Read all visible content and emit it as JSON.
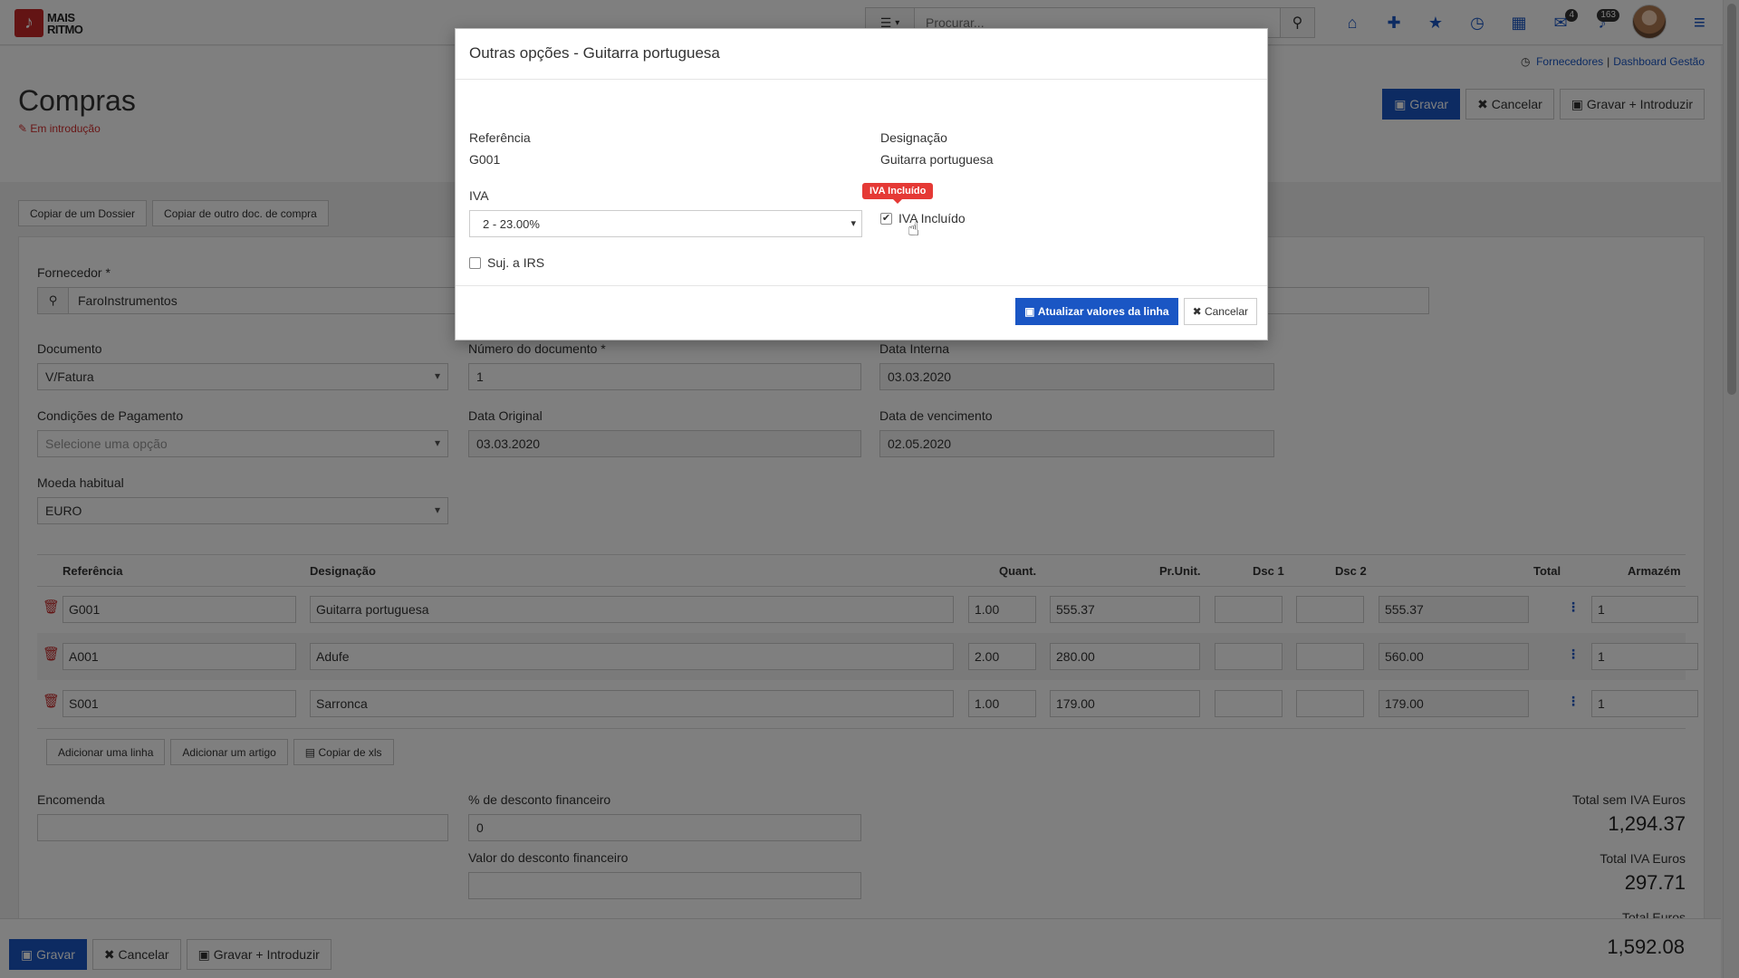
{
  "brand": {
    "line1": "MAIS",
    "line2": "RITMO",
    "color": "#c62828"
  },
  "search": {
    "placeholder": "Procurar..."
  },
  "nav": {
    "mail_badge": "4",
    "notif_badge": "163"
  },
  "breadcrumb": {
    "item1": "Fornecedores",
    "separator": "|",
    "item2": "Dashboard Gestão"
  },
  "page": {
    "title": "Compras",
    "status": "Em introdução"
  },
  "header_buttons": {
    "save": "Gravar",
    "cancel": "Cancelar",
    "save_new": "Gravar + Introduzir"
  },
  "copy_buttons": {
    "from_dossier": "Copiar de um Dossier",
    "from_other": "Copiar de outro doc. de compra"
  },
  "form": {
    "fornecedor_label": "Fornecedor *",
    "fornecedor_value": "FaroInstrumentos",
    "documento_label": "Documento",
    "documento_value": "V/Fatura",
    "numero_label": "Número do documento *",
    "numero_value": "1",
    "data_interna_label": "Data Interna",
    "data_interna_value": "03.03.2020",
    "condicoes_label": "Condições de Pagamento",
    "condicoes_placeholder": "Selecione uma opção",
    "data_original_label": "Data Original",
    "data_original_value": "03.03.2020",
    "data_venc_label": "Data de vencimento",
    "data_venc_value": "02.05.2020",
    "moeda_label": "Moeda habitual",
    "moeda_value": "EURO"
  },
  "grid": {
    "headers": {
      "ref": "Referência",
      "des": "Designação",
      "qty": "Quant.",
      "price": "Pr.Unit.",
      "dsc1": "Dsc 1",
      "dsc2": "Dsc 2",
      "total": "Total",
      "armazem": "Armazém"
    },
    "rows": [
      {
        "ref": "G001",
        "des": "Guitarra portuguesa",
        "qty": "1.00",
        "price": "555.37",
        "total": "555.37",
        "armazem": "1"
      },
      {
        "ref": "A001",
        "des": "Adufe",
        "qty": "2.00",
        "price": "280.00",
        "total": "560.00",
        "armazem": "1"
      },
      {
        "ref": "S001",
        "des": "Sarronca",
        "qty": "1.00",
        "price": "179.00",
        "total": "179.00",
        "armazem": "1"
      }
    ],
    "buttons": {
      "add_line": "Adicionar uma linha",
      "add_article": "Adicionar um artigo",
      "copy_xls": "Copiar de xls"
    }
  },
  "footer_form": {
    "encomenda_label": "Encomenda",
    "desconto_pct_label": "% de desconto financeiro",
    "desconto_pct_value": "0",
    "desconto_val_label": "Valor do desconto financeiro"
  },
  "totals": {
    "sem_iva_label": "Total sem IVA Euros",
    "sem_iva_value": "1,294.37",
    "iva_label": "Total IVA Euros",
    "iva_value": "297.71",
    "total_label": "Total Euros",
    "total_value": "1,592.08"
  },
  "bottom_buttons": {
    "save": "Gravar",
    "cancel": "Cancelar",
    "save_new": "Gravar + Introduzir"
  },
  "modal": {
    "title": "Outras opções - Guitarra portuguesa",
    "ref_label": "Referência",
    "ref_value": "G001",
    "des_label": "Designação",
    "des_value": "Guitarra portuguesa",
    "iva_label": "IVA",
    "iva_value": "2 - 23.00%",
    "iva_incluido_label": "IVA Incluído",
    "iva_incluido_tooltip": "IVA Incluído",
    "irs_label": "Suj. a IRS",
    "update_button": "Atualizar valores da linha",
    "cancel_button": "Cancelar"
  },
  "colors": {
    "primary": "#1a56c4",
    "danger": "#e53935"
  }
}
